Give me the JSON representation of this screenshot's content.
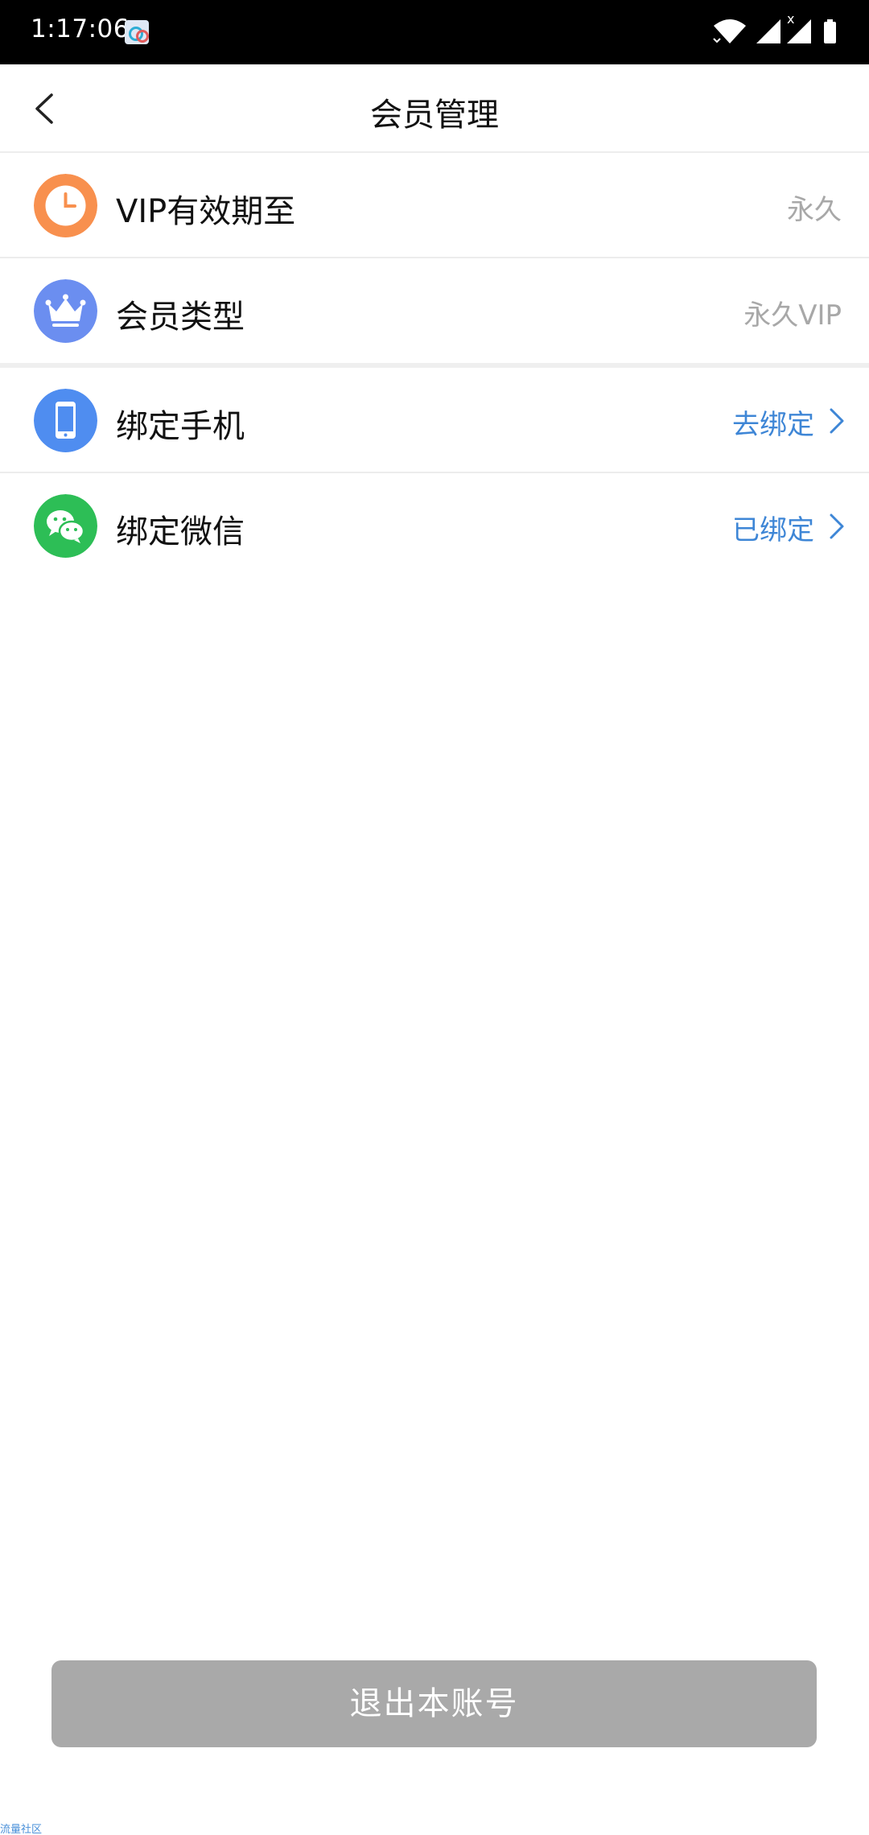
{
  "status_bar": {
    "time": "1:17:06",
    "signal_x": "x"
  },
  "header": {
    "title": "会员管理"
  },
  "rows": [
    {
      "label": "VIP有效期至",
      "value": "永久",
      "icon": "clock-icon",
      "icon_color": "#F8904E"
    },
    {
      "label": "会员类型",
      "value": "永久VIP",
      "icon": "crown-icon",
      "icon_color": "#6B8EF0"
    },
    {
      "label": "绑定手机",
      "value": "去绑定",
      "icon": "phone-icon",
      "icon_color": "#4F8DF0"
    },
    {
      "label": "绑定微信",
      "value": "已绑定",
      "icon": "wechat-icon",
      "icon_color": "#2DBE56"
    }
  ],
  "footer": {
    "logout_label": "退出本账号",
    "watermark": "流量社区"
  },
  "colors": {
    "link": "#3E86D6",
    "muted_value": "#A8A8A8",
    "logout_bg": "#A9A9A9"
  }
}
